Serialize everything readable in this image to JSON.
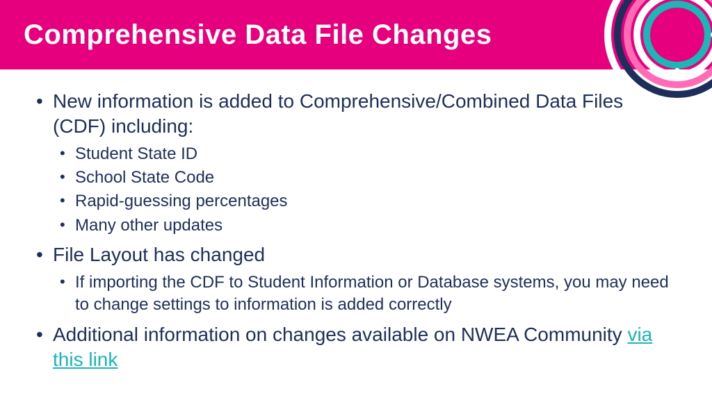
{
  "header": {
    "title": "Comprehensive Data File Changes"
  },
  "bullets": {
    "b1": "New information is added to Comprehensive/Combined Data Files (CDF) including:",
    "b1_subs": {
      "s1": "Student State ID",
      "s2": "School State Code",
      "s3": "Rapid-guessing percentages",
      "s4": "Many other updates"
    },
    "b2": "File Layout has changed",
    "b2_subs": {
      "s1": "If importing the CDF to Student Information or Database systems, you may need to change settings to information is added correctly"
    },
    "b3_pre": "Additional information on changes available on NWEA Community ",
    "b3_link": "via this link"
  }
}
